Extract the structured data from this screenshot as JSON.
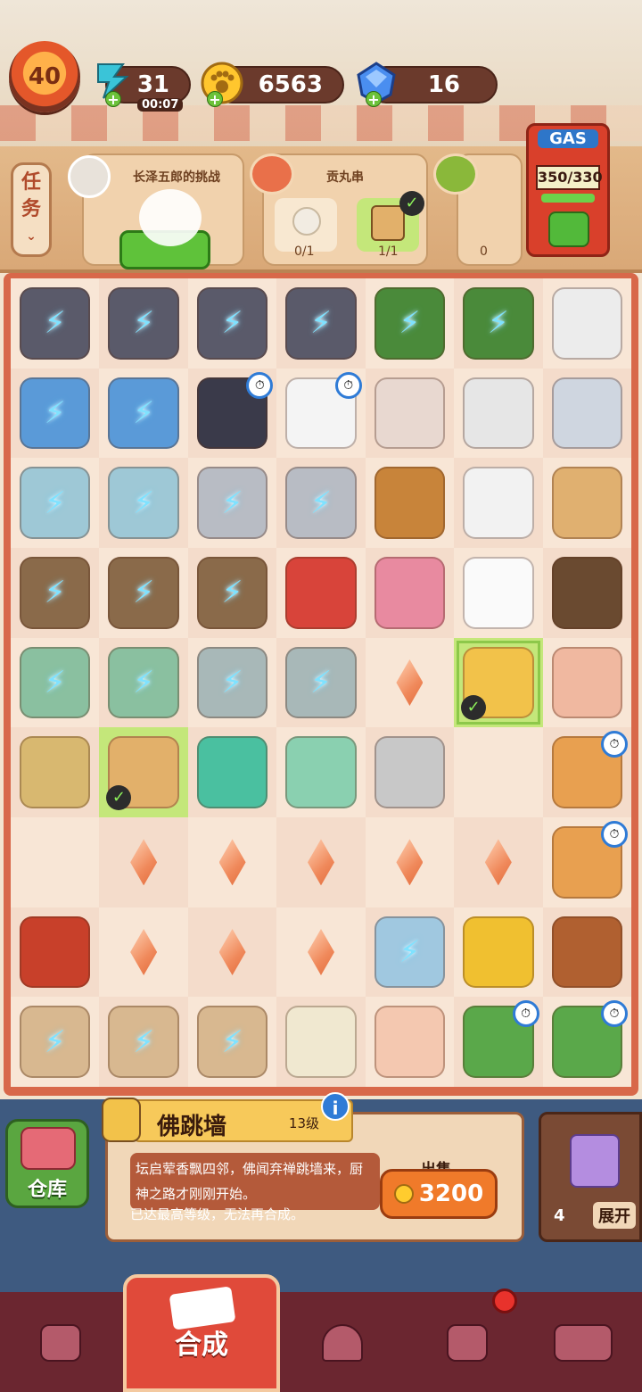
{
  "status": {
    "level": "40",
    "energy": "31",
    "energy_timer": "00:07",
    "coins": "6563",
    "gems": "16"
  },
  "tasks": {
    "tab_label_1": "任",
    "tab_label_2": "务",
    "card1_title": "长泽五郎的挑战",
    "card2_title": "贡丸串",
    "card2_slot1": "0/1",
    "card2_slot2": "1/1",
    "card3_slot1": "0"
  },
  "gas": {
    "label": "GAS",
    "value": "350/330",
    "fill": 1.0
  },
  "board": {
    "rows": 9,
    "cols": 7
  },
  "info": {
    "item_name": "佛跳墙",
    "item_level": "13级",
    "description": "坛启荤香飘四邻，佛闻弃禅跳墙来，厨神之路才刚刚开始。",
    "max_note": "已达最高等级，无法再合成。",
    "sell_label": "出售",
    "sell_price": "3200",
    "info_icon": "i"
  },
  "warehouse": {
    "label": "仓库"
  },
  "expand": {
    "count": "4",
    "label": "展开"
  },
  "nav": {
    "active_label": "合成"
  },
  "colors": {
    "board_border": "#d8684a",
    "accent_green": "#5fc23a",
    "bolt": "#7fe2ff"
  }
}
